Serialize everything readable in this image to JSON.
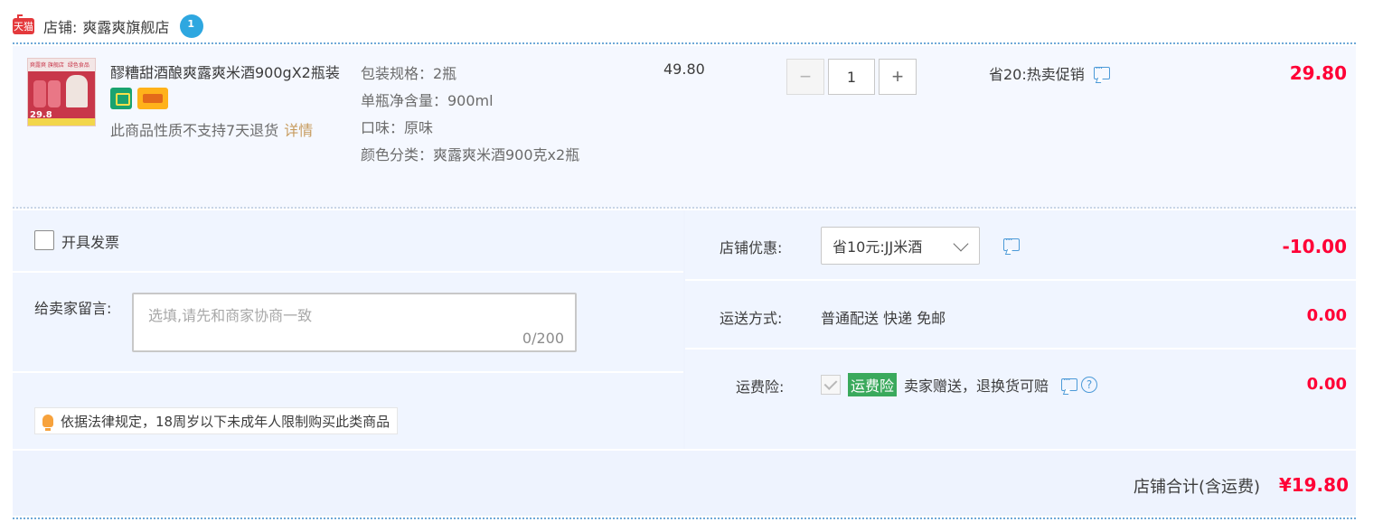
{
  "shop": {
    "platform_badge": "天猫",
    "label": "店铺:",
    "name": "爽露爽旗舰店"
  },
  "item": {
    "title": "醪糟甜酒酿爽露爽米酒900gX2瓶装",
    "thumb_text_left": "爽露爽 旗舰店",
    "thumb_text_right": "绿色食品",
    "thumb_price": "29.8",
    "return_note": "此商品性质不支持7天退货",
    "detail_link": "详情",
    "specs": [
      "包装规格：2瓶",
      "单瓶净含量：900ml",
      "口味：原味",
      "颜色分类：爽露爽米酒900克x2瓶"
    ],
    "unit_price": "49.80",
    "quantity": "1",
    "qty_minus": "−",
    "qty_plus": "+",
    "promotion": "省20:热卖促销",
    "subtotal": "29.80"
  },
  "invoice": {
    "label": "开具发票",
    "checked": false
  },
  "message": {
    "label": "给卖家留言:",
    "placeholder": "选填,请先和商家协商一致",
    "value": "",
    "counter": "0/200"
  },
  "age_notice": "依据法律规定，18周岁以下未成年人限制购买此类商品",
  "discount": {
    "label": "店铺优惠:",
    "selected": "省10元:JJ米酒",
    "amount": "-10.00"
  },
  "shipping": {
    "label": "运送方式:",
    "value": "普通配送 快递 免邮",
    "amount": "0.00"
  },
  "insurance": {
    "label": "运费险:",
    "tag": "运费险",
    "description": "卖家赠送，退换货可赔",
    "amount": "0.00"
  },
  "summary": {
    "label": "店铺合计(含运费)",
    "amount": "¥19.80"
  },
  "colors": {
    "price_red": "#ff0036",
    "panel_bg": "#eef3fe",
    "accent_blue": "#4c9ad8",
    "insurance_green": "#3aa95c",
    "detail_link": "#c79b5e"
  },
  "icons": [
    "tmall-logo",
    "wangwang-icon",
    "comment-icon",
    "chevron-down-icon",
    "help-icon",
    "bulb-icon",
    "checkbox"
  ]
}
